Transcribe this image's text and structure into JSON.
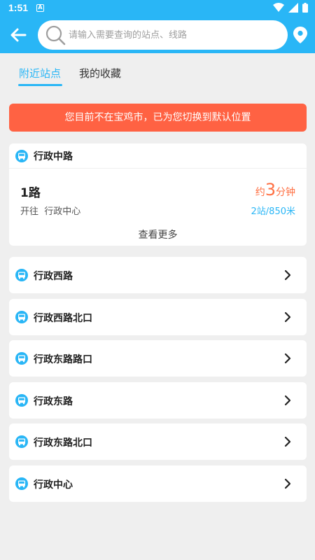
{
  "status_bar": {
    "time": "1:51",
    "notification_badge": "A"
  },
  "colors": {
    "primary": "#29b6f6",
    "banner": "#ff6243",
    "eta": "#ff7043"
  },
  "search": {
    "placeholder": "请输入需要查询的站点、线路"
  },
  "tabs": [
    {
      "label": "附近站点",
      "active": true
    },
    {
      "label": "我的收藏",
      "active": false
    }
  ],
  "banner": {
    "text": "您目前不在宝鸡市，已为您切换到默认位置"
  },
  "nearest_stop": {
    "name": "行政中路",
    "route": "1路",
    "toward_label": "开往",
    "toward": "行政中心",
    "eta_prefix": "约",
    "eta_number": "3",
    "eta_unit": "分钟",
    "distance": "2站/850米",
    "more": "查看更多"
  },
  "stops": [
    {
      "name": "行政西路"
    },
    {
      "name": "行政西路北口"
    },
    {
      "name": "行政东路路口"
    },
    {
      "name": "行政东路"
    },
    {
      "name": "行政东路北口"
    },
    {
      "name": "行政中心"
    }
  ],
  "icons": {
    "back": "arrow-left-icon",
    "search": "search-icon",
    "location": "location-pin-icon",
    "stop": "bus-stop-icon",
    "chevron": "chevron-right-icon"
  }
}
